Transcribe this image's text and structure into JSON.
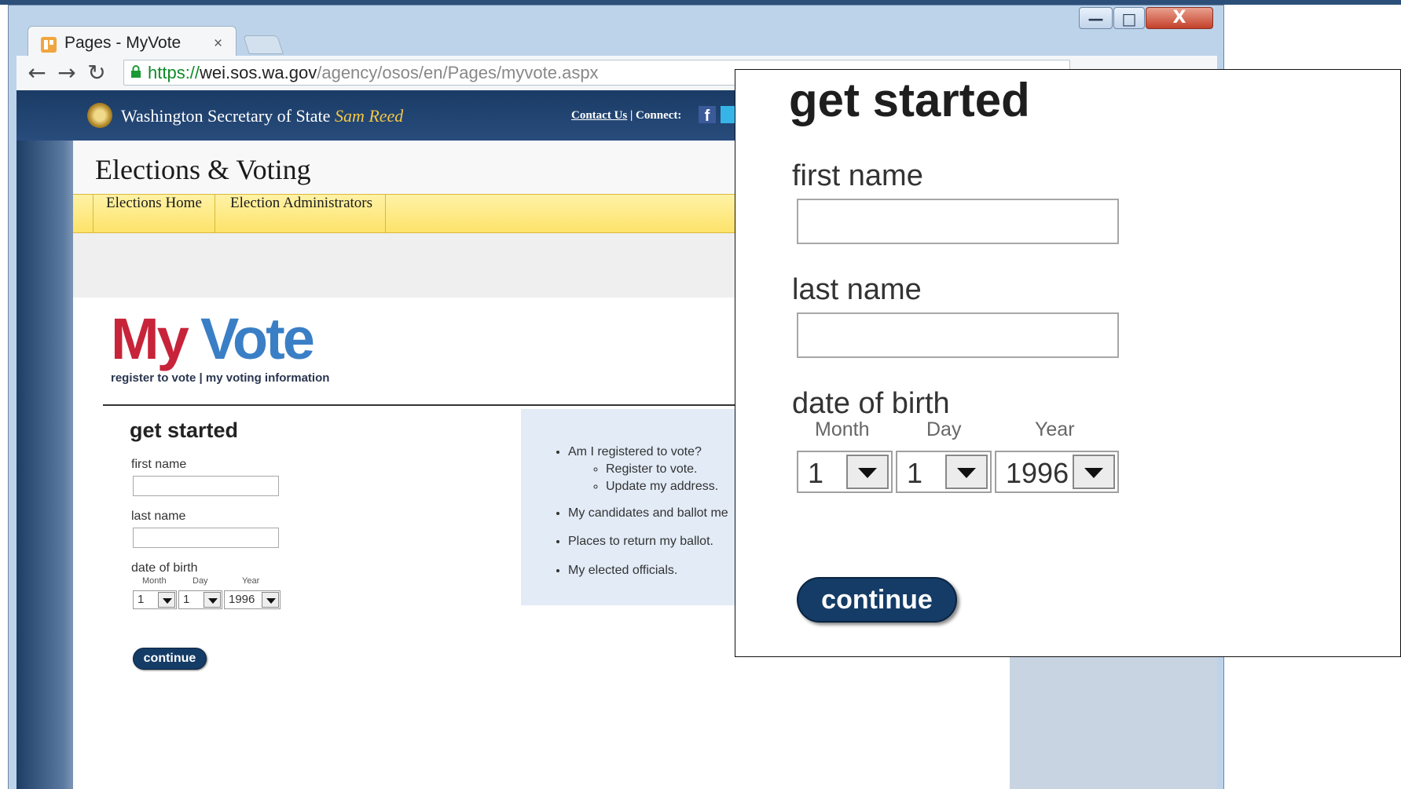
{
  "browser": {
    "tab_title": "Pages - MyVote",
    "tab_close": "×",
    "url_scheme": "https://",
    "url_host": "wei.sos.wa.gov",
    "url_path": "/agency/osos/en/Pages/myvote.aspx",
    "back_glyph": "←",
    "forward_glyph": "→",
    "reload_glyph": "↻",
    "window_min": "—",
    "window_max": "□",
    "window_close": "X"
  },
  "site": {
    "org_name": "Washington Secretary of State",
    "secretary": "Sam Reed",
    "contact_link": "Contact Us",
    "connect_label": "| Connect:",
    "facebook_glyph": "f",
    "section_title": "Elections & Voting",
    "menu": [
      "Elections Home",
      "Election Administrators"
    ]
  },
  "logo": {
    "my": "My",
    "vote": "Vote",
    "tagline": "register to vote | my voting information"
  },
  "form": {
    "heading": "get started",
    "first_name_label": "first name",
    "first_name_value": "",
    "last_name_label": "last name",
    "last_name_value": "",
    "dob_label": "date of birth",
    "month_label": "Month",
    "day_label": "Day",
    "year_label": "Year",
    "month_value": "1",
    "day_value": "1",
    "year_value": "1996",
    "continue_label": "continue"
  },
  "info_links": {
    "registered": "Am I registered to vote?",
    "register": "Register to vote.",
    "update": "Update my address.",
    "candidates": "My candidates and ballot me",
    "places": "Places to return my ballot.",
    "officials": "My elected officials."
  },
  "colors": {
    "header_blue": "#1a3b65",
    "menu_yellow": "#fde36a",
    "logo_red": "#c7243a",
    "logo_blue": "#3a7fc6",
    "button_navy": "#143c66"
  }
}
